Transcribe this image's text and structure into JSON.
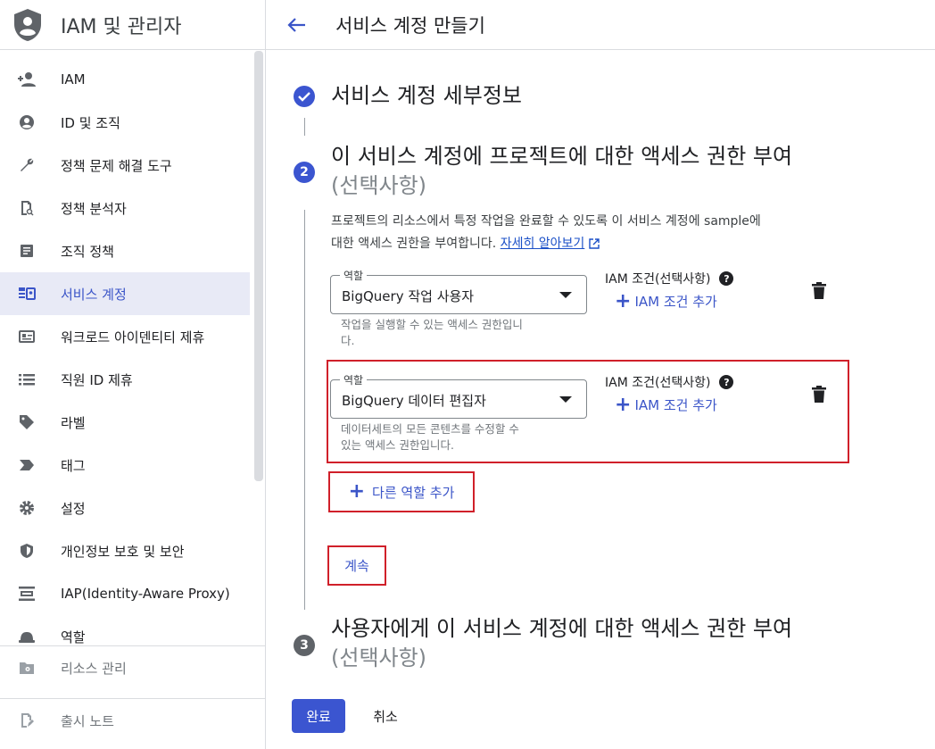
{
  "sidebar": {
    "title": "IAM 및 관리자",
    "items": [
      {
        "label": "IAM",
        "icon": "person-add-icon"
      },
      {
        "label": "ID 및 조직",
        "icon": "account-circle-icon"
      },
      {
        "label": "정책 문제 해결 도구",
        "icon": "wrench-icon"
      },
      {
        "label": "정책 분석자",
        "icon": "document-search-icon"
      },
      {
        "label": "조직 정책",
        "icon": "article-icon"
      },
      {
        "label": "서비스 계정",
        "icon": "service-account-icon"
      },
      {
        "label": "워크로드 아이덴티티 제휴",
        "icon": "id-card-icon"
      },
      {
        "label": "직원 ID 제휴",
        "icon": "list-icon"
      },
      {
        "label": "라벨",
        "icon": "tag-icon"
      },
      {
        "label": "태그",
        "icon": "label-chevron-icon"
      },
      {
        "label": "설정",
        "icon": "gear-icon"
      },
      {
        "label": "개인정보 보호 및 보안",
        "icon": "shield-icon"
      },
      {
        "label": "IAP(Identity-Aware Proxy)",
        "icon": "iap-icon"
      },
      {
        "label": "역할",
        "icon": "hat-icon"
      }
    ],
    "active_index": 5,
    "footer": {
      "resource_manage": "리소스 관리",
      "release_notes": "출시 노트"
    }
  },
  "header": {
    "title": "서비스 계정 만들기"
  },
  "steps": {
    "step1": {
      "title": "서비스 계정 세부정보"
    },
    "step2": {
      "number": "2",
      "title": "이 서비스 계정에 프로젝트에 대한 액세스 권한 부여",
      "optional": "(선택사항)",
      "description_line1": "프로젝트의 리소스에서 특정 작업을 완료할 수 있도록 이 서비스 계정에 sample에",
      "description_line2": "대한 액세스 권한을 부여합니다.",
      "learn_more": "자세히 알아보기"
    },
    "step3": {
      "number": "3",
      "title": "사용자에게 이 서비스 계정에 대한 액세스 권한 부여",
      "optional": "(선택사항)"
    }
  },
  "roles": [
    {
      "field_label": "역할",
      "value": "BigQuery 작업 사용자",
      "help_line1": "작업을 실행할 수 있는 액세스 권한입니",
      "help_line2": "다.",
      "iam_condition_label": "IAM 조건(선택사항)",
      "add_iam_condition": "IAM 조건 추가"
    },
    {
      "field_label": "역할",
      "value": "BigQuery 데이터 편집자",
      "help_line1": "데이터세트의 모든 콘텐츠를 수정할 수",
      "help_line2": "있는 액세스 권한입니다.",
      "iam_condition_label": "IAM 조건(선택사항)",
      "add_iam_condition": "IAM 조건 추가"
    }
  ],
  "actions": {
    "add_role": "다른 역할 추가",
    "continue": "계속",
    "done": "완료",
    "cancel": "취소"
  },
  "colors": {
    "accent": "#3b55d0",
    "highlight_red": "#d0202a",
    "active_bg": "#e8eaf6"
  }
}
